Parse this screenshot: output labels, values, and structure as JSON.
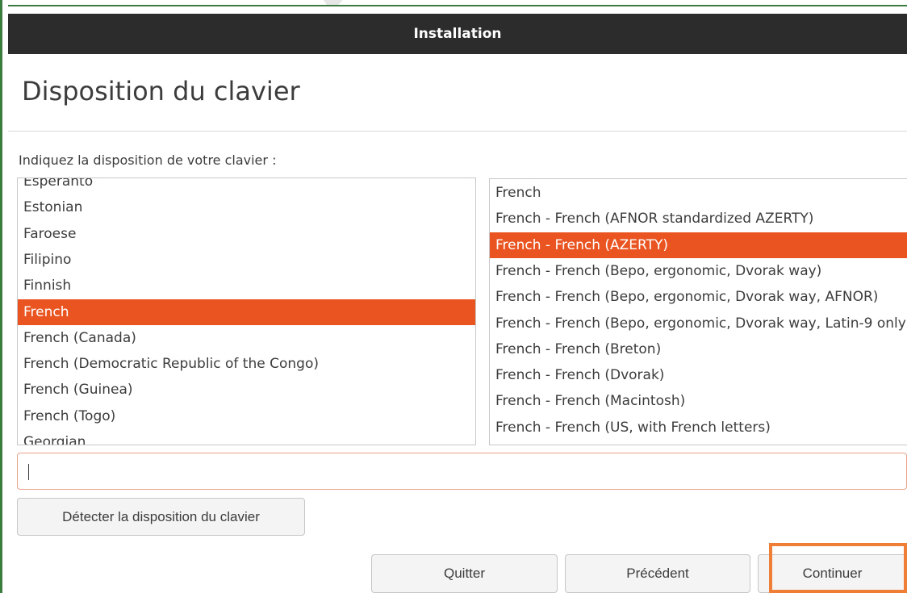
{
  "window": {
    "title": "Installation"
  },
  "page": {
    "title": "Disposition du clavier",
    "prompt": "Indiquez la disposition de votre clavier :"
  },
  "layouts": {
    "items": [
      "Esperanto",
      "Estonian",
      "Faroese",
      "Filipino",
      "Finnish",
      "French",
      "French (Canada)",
      "French (Democratic Republic of the Congo)",
      "French (Guinea)",
      "French (Togo)",
      "Georgian"
    ],
    "selected": "French"
  },
  "variants": {
    "items": [
      "French",
      "French - French (AFNOR standardized AZERTY)",
      "French - French (AZERTY)",
      "French - French (Bepo, ergonomic, Dvorak way)",
      "French - French (Bepo, ergonomic, Dvorak way, AFNOR)",
      "French - French (Bepo, ergonomic, Dvorak way, Latin-9 only)",
      "French - French (Breton)",
      "French - French (Dvorak)",
      "French - French (Macintosh)",
      "French - French (US, with French letters)"
    ],
    "selected": "French - French (AZERTY)"
  },
  "test_input": {
    "value": "",
    "placeholder": ""
  },
  "buttons": {
    "detect": "Détecter la disposition du clavier",
    "quit": "Quitter",
    "previous": "Précédent",
    "continue": "Continuer"
  },
  "colors": {
    "accent": "#e95420",
    "titlebar": "#2c2c2c",
    "highlight_frame": "#ef7f37",
    "window_edge": "#3b7d3f"
  }
}
